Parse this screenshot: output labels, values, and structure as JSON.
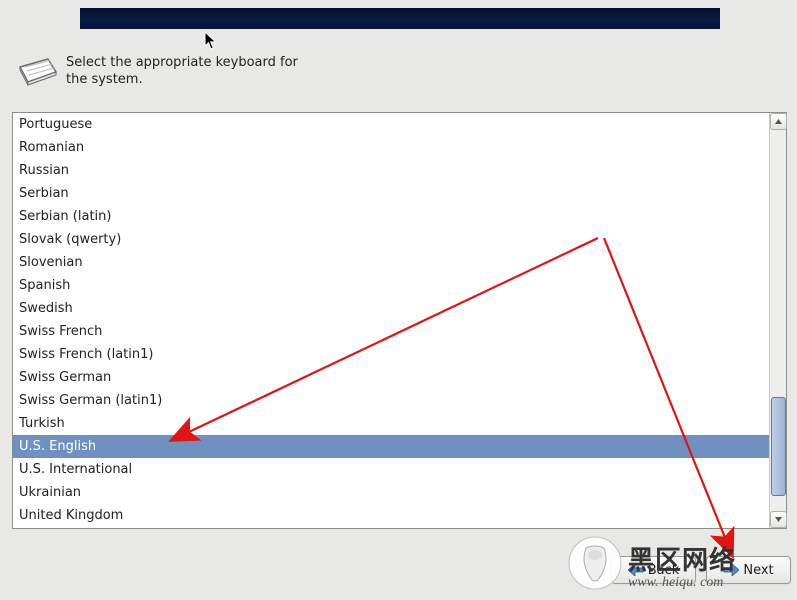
{
  "instruction": "Select the appropriate keyboard for the system.",
  "keyboards": [
    "Portuguese",
    "Romanian",
    "Russian",
    "Serbian",
    "Serbian (latin)",
    "Slovak (qwerty)",
    "Slovenian",
    "Spanish",
    "Swedish",
    "Swiss French",
    "Swiss French (latin1)",
    "Swiss German",
    "Swiss German (latin1)",
    "Turkish",
    "U.S. English",
    "U.S. International",
    "Ukrainian",
    "United Kingdom"
  ],
  "selected_keyboard": "U.S. English",
  "buttons": {
    "back": "Back",
    "next": "Next"
  },
  "watermark": {
    "title": "黑区网络",
    "url": "www. heiqu. com"
  },
  "scrollbar": {
    "thumb_start_pct": 70,
    "thumb_height_pct": 26
  }
}
